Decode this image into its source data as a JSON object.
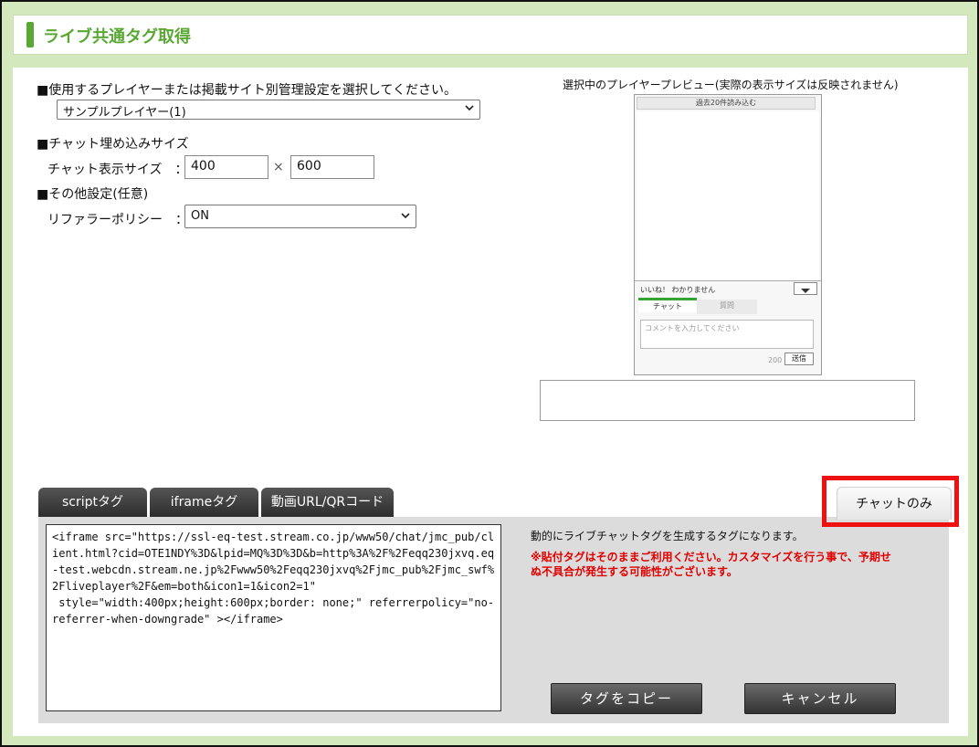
{
  "title": "ライブ共通タグ取得",
  "player_section": {
    "heading": "■使用するプレイヤーまたは掲載サイト別管理設定を選択してください。",
    "selected": "サンプルプレイヤー(1)"
  },
  "size_section": {
    "heading": "■チャット埋め込みサイズ",
    "label": "チャット表示サイズ　：",
    "width_value": "400",
    "separator": "×",
    "height_value": "600"
  },
  "other_section": {
    "heading": "■その他設定(任意)",
    "label": "リファラーポリシー　：",
    "selected": "ON"
  },
  "preview": {
    "caption": "選択中のプレイヤープレビュー(実際の表示サイズは反映されません)",
    "load_label": "過去20件読み込む",
    "reactions": "いいね！  わかりません",
    "tab_chat": "チャット",
    "tab_question": "質問",
    "comment_placeholder": "コメントを入力してください",
    "char_count": "200",
    "send_label": "送信"
  },
  "tabs": {
    "script": "scriptタグ",
    "iframe": "iframeタグ",
    "video_url": "動画URL/QRコード",
    "chat_only": "チャットのみ"
  },
  "code": "<iframe src=\"https://ssl-eq-test.stream.co.jp/www50/chat/jmc_pub/client.html?cid=OTE1NDY%3D&lpid=MQ%3D%3D&b=http%3A%2F%2Feqq230jxvq.eq-test.webcdn.stream.ne.jp%2Fwww50%2Feqq230jxvq%2Fjmc_pub%2Fjmc_swf%2Fliveplayer%2F&em=both&icon1=1&icon2=1\"\n style=\"width:400px;height:600px;border: none;\" referrerpolicy=\"no-referrer-when-downgrade\" ></iframe>",
  "info": "動的にライブチャットタグを生成するタグになります。",
  "warning": "※貼付タグはそのままご利用ください。カスタマイズを行う事で、予期せぬ不具合が発生する可能性がございます。",
  "buttons": {
    "copy": "タグをコピー",
    "cancel": "キャンセル"
  },
  "colors": {
    "accent_green": "#5aa834",
    "highlight_red": "#ee1111",
    "warning_red": "#e00000"
  }
}
